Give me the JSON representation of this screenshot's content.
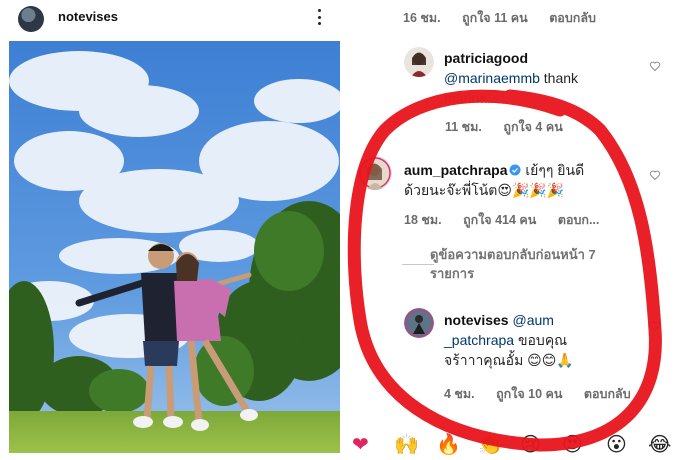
{
  "post": {
    "username": "notevises",
    "more_icon": "kebab-menu-icon"
  },
  "top_meta": {
    "time": "16 ชม.",
    "likes": "ถูกใจ 11 คน",
    "reply": "ตอบกลับ"
  },
  "comments": [
    {
      "username": "patriciagood",
      "mention": "@marinaemmb",
      "text": " thank",
      "text_faded": "marina...",
      "time": "11 ชม.",
      "likes": "ถูกใจ 4 คน"
    },
    {
      "username": "aum_patchrapa",
      "verified": true,
      "text_line1": " เย้ๆๆ ยินดี",
      "text_line2": "ด้วยนะจ๊ะพี่โน้ต😍🎉🎉🎉",
      "time": "18 ชม.",
      "likes": "ถูกใจ 414 คน",
      "reply": "ตอบก..."
    },
    {
      "username": "notevises",
      "mention_line1": "@aum",
      "mention_line2": "_patchrapa",
      "text_line2": " ขอบคุณ",
      "text_line3": "จร้าาาคุณอั้ม 😊😊🙏",
      "time": "4 ชม.",
      "likes": "ถูกใจ 10 คน",
      "reply": "ตอบกลับ"
    }
  ],
  "view_replies": "ดูข้อความตอบกลับก่อนหน้า 7 รายการ",
  "emoji_bar": [
    "❤",
    "🙌",
    "🔥",
    "👏",
    "😢",
    "😍",
    "😮",
    "😂"
  ],
  "colors": {
    "annotation_red": "#e8141b",
    "link_blue": "#00376b",
    "meta_gray": "#6b6b6b",
    "verified_blue": "#3897f0"
  }
}
